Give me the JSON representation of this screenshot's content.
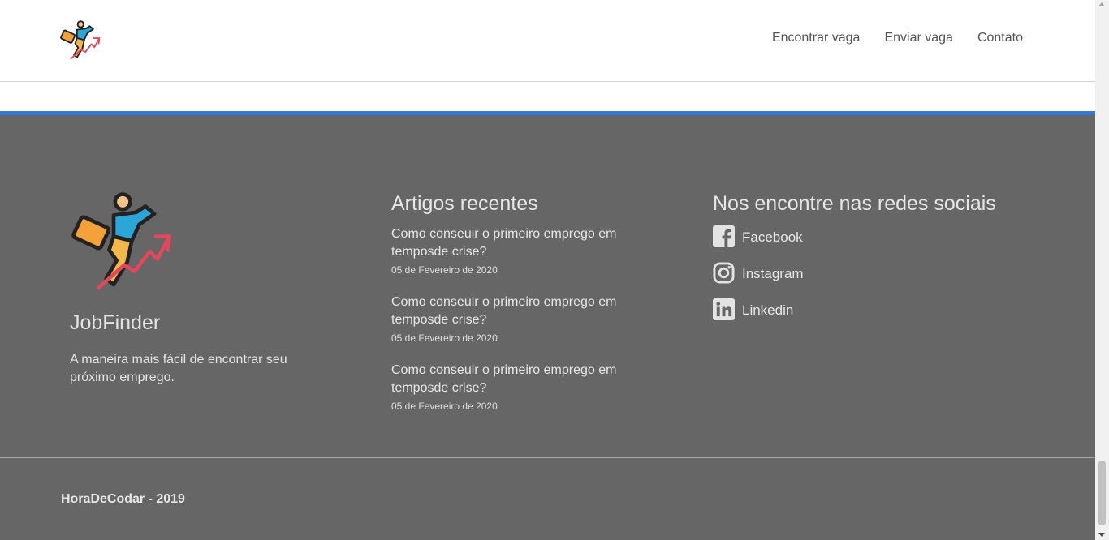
{
  "header": {
    "nav": [
      {
        "label": "Encontrar vaga"
      },
      {
        "label": "Enviar vaga"
      },
      {
        "label": "Contato"
      }
    ]
  },
  "colors": {
    "accent": "#3478db",
    "footer_bg": "#666666"
  },
  "footer": {
    "brand": {
      "name": "JobFinder",
      "tagline": "A maneira mais fácil de encontrar seu próximo emprego."
    },
    "articles": {
      "title": "Artigos recentes",
      "items": [
        {
          "title": "Como conseuir o primeiro emprego em temposde crise?",
          "date": "05 de Fevereiro de 2020"
        },
        {
          "title": "Como conseuir o primeiro emprego em temposde crise?",
          "date": "05 de Fevereiro de 2020"
        },
        {
          "title": "Como conseuir o primeiro emprego em temposde crise?",
          "date": "05 de Fevereiro de 2020"
        }
      ]
    },
    "social": {
      "title": "Nos encontre nas redes sociais",
      "items": [
        {
          "label": "Facebook",
          "icon": "facebook-icon"
        },
        {
          "label": "Instagram",
          "icon": "instagram-icon"
        },
        {
          "label": "Linkedin",
          "icon": "linkedin-icon"
        }
      ]
    },
    "copyright": "HoraDeCodar - 2019"
  }
}
